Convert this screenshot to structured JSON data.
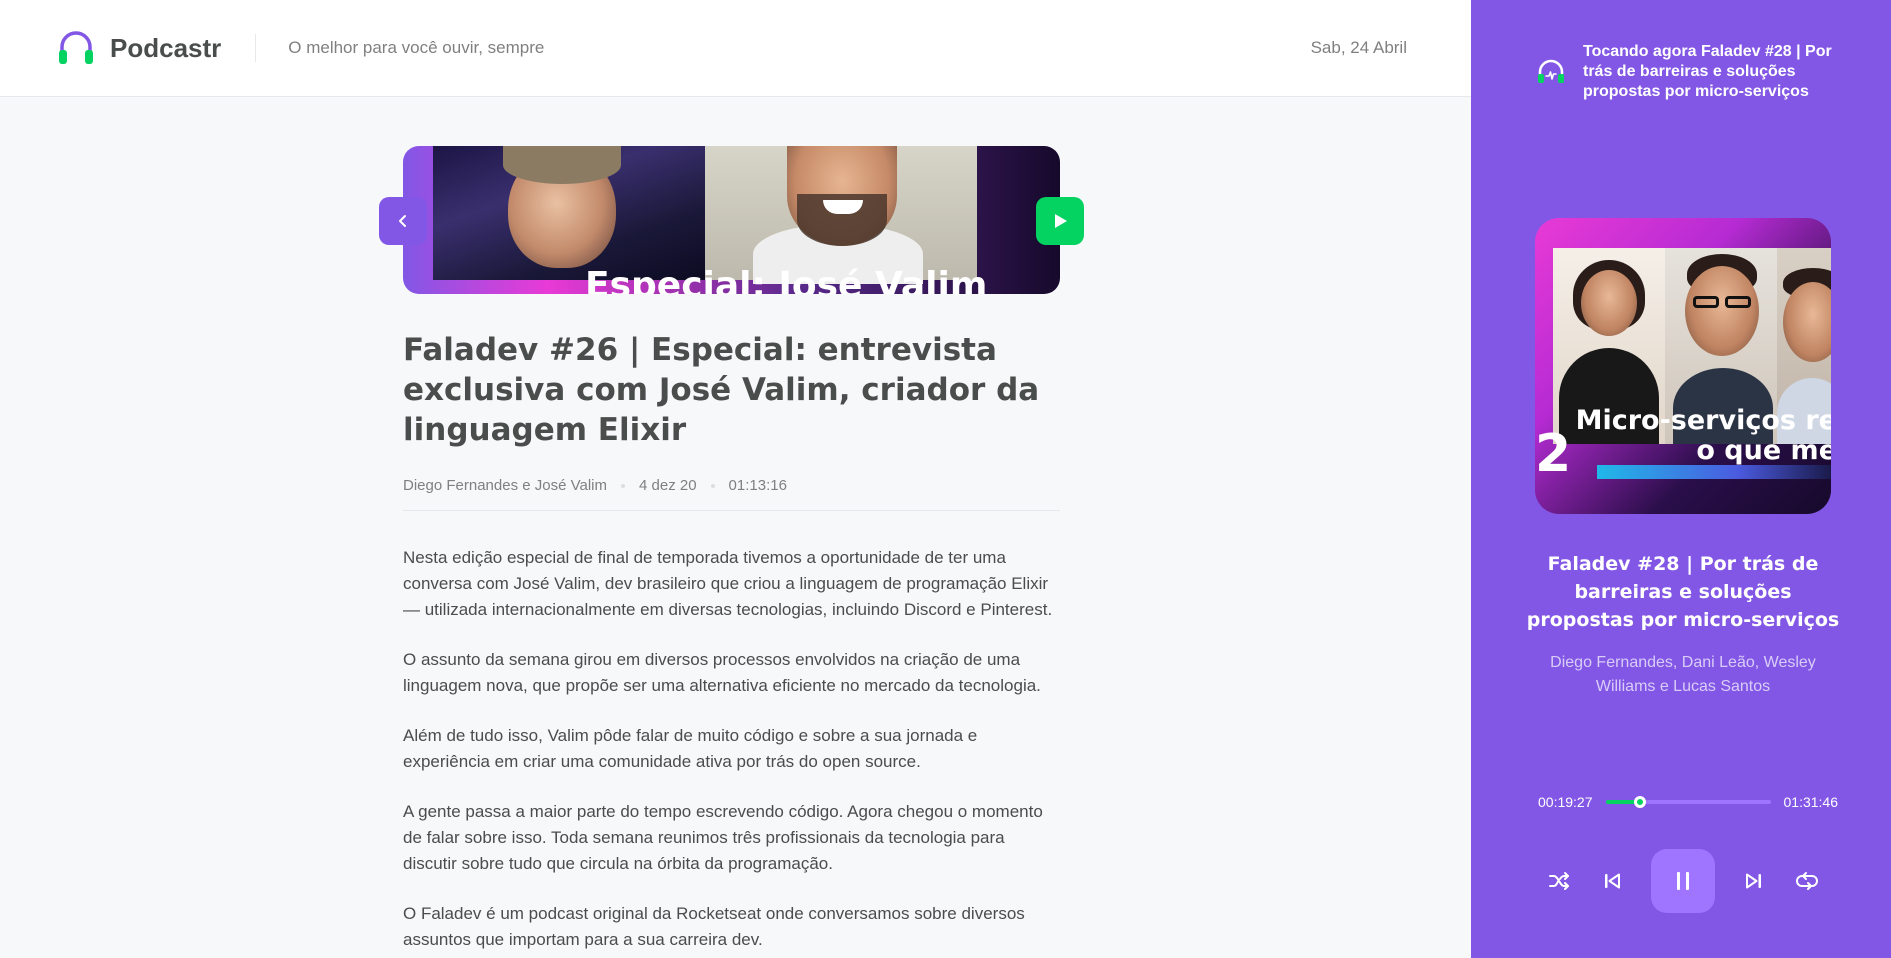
{
  "app": {
    "name": "Podcastr",
    "tagline": "O melhor para você ouvir, sempre",
    "date": "Sab, 24 Abril"
  },
  "episode": {
    "thumbnail_caption": "Especial: José Valim",
    "title": "Faladev #26 | Especial: entrevista exclusiva com José Valim, criador da linguagem Elixir",
    "members": "Diego Fernandes e José Valim",
    "published_at": "4 dez 20",
    "duration": "01:13:16",
    "description": [
      "Nesta edição especial de final de temporada tivemos a oportunidade de ter uma conversa com José Valim, dev brasileiro que criou a linguagem de programação Elixir — utilizada internacionalmente em diversas tecnologias, incluindo Discord e Pinterest.",
      "O assunto da semana girou em diversos processos envolvidos na criação de uma linguagem nova, que propõe ser uma alternativa eficiente no mercado da tecnologia.",
      "Além de tudo isso, Valim pôde falar de muito código e sobre a sua jornada e experiência em criar uma comunidade ativa por trás do open source.",
      "A gente passa a maior parte do tempo escrevendo código. Agora chegou o momento de falar sobre isso. Toda semana reunimos três profissionais da tecnologia para discutir sobre tudo que circula na órbita da programação.",
      "O Faladev é um podcast original da Rocketseat onde conversamos sobre diversos assuntos que importam para a sua carreira dev."
    ]
  },
  "player": {
    "now_playing": "Tocando agora Faladev #28 | Por trás de barreiras e soluções propostas por micro-serviços",
    "cover_caption_line1": "Micro-serviços re",
    "cover_caption_line2": "o que me",
    "cover_number": "2",
    "title": "Faladev #28 | Por trás de barreiras e soluções propostas por micro-serviços",
    "members": "Diego Fernandes, Dani Leão, Wesley Williams e Lucas Santos",
    "current_time": "00:19:27",
    "total_time": "01:31:46",
    "progress": 0.21
  },
  "colors": {
    "brand_purple": "#8257e5",
    "accent_green": "#04d361",
    "light_purple": "#9f75ff"
  },
  "icons": {
    "back": "chevron-left-icon",
    "play": "play-icon",
    "shuffle": "shuffle-icon",
    "previous": "skip-previous-icon",
    "pause": "pause-icon",
    "next": "skip-next-icon",
    "repeat": "repeat-icon"
  }
}
